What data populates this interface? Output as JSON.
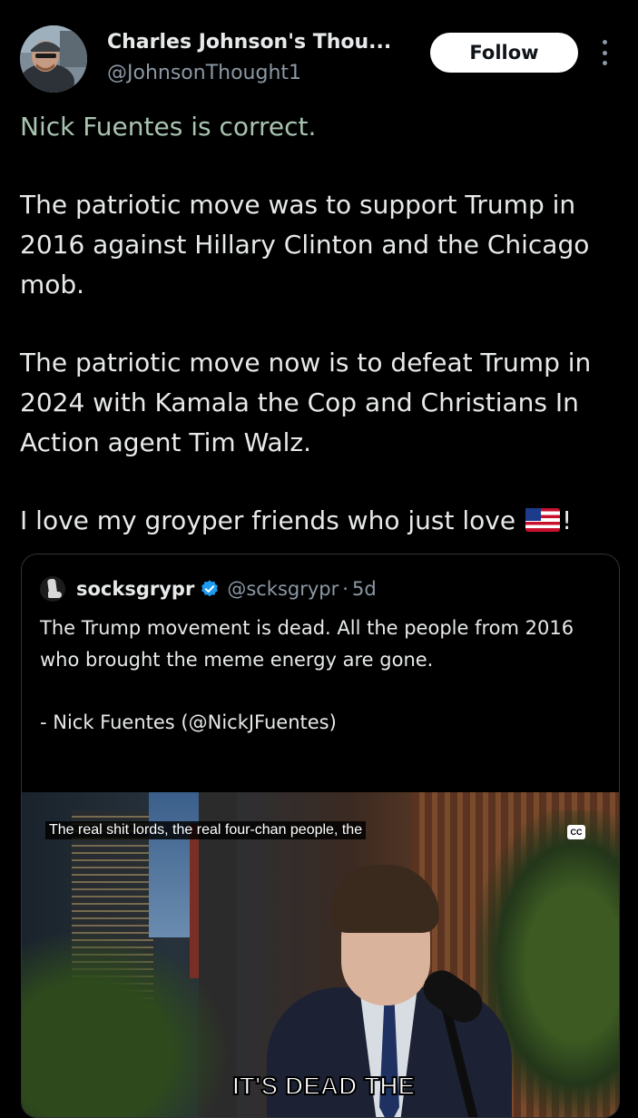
{
  "author": {
    "display_name": "Charles Johnson's Thou...",
    "handle": "@JohnsonThought1",
    "avatar_icon": "avatar-photo"
  },
  "follow_label": "Follow",
  "post": {
    "lines": [
      "Nick Fuentes is correct.",
      "The patriotic move was to support Trump in 2016 against Hillary Clinton and the Chicago mob.",
      "The patriotic move now is to defeat Trump in 2024 with Kamala the Cop and Christians In Action agent Tim Walz.",
      "I love my groyper friends who just love"
    ],
    "end_punct": "!",
    "flag_icon": "us-flag-emoji"
  },
  "quoted": {
    "name": "socksgrypr",
    "handle": "@scksgrypr",
    "separator": "·",
    "time": "5d",
    "text_1": "The Trump movement is dead. All the people from 2016 who brought the meme energy are gone.",
    "text_2": "- Nick Fuentes (@NickJFuentes)",
    "video": {
      "caption": "The real shit lords, the real four-chan people, the",
      "cc_label": "CC",
      "burned_text": "IT'S DEAD THE"
    }
  },
  "colors": {
    "background": "#000000",
    "text": "#e7e9ea",
    "secondary": "#8b98a5",
    "first_line": "#a8c4b1",
    "verified": "#1d9bf0"
  }
}
